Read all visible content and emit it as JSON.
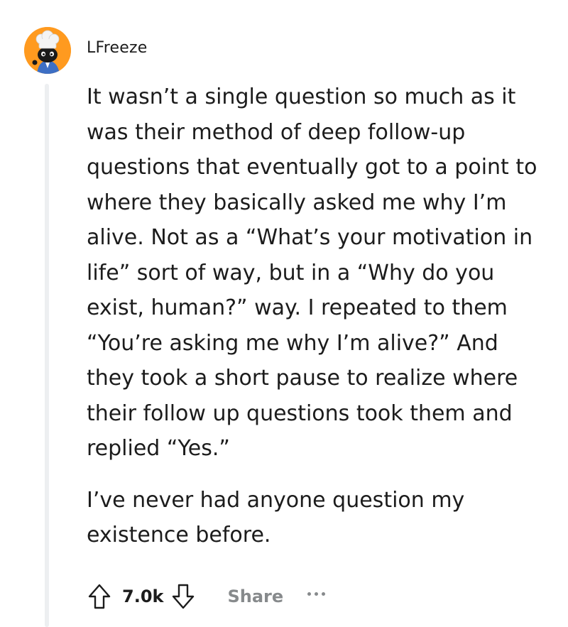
{
  "comment": {
    "username": "LFreeze",
    "paragraphs": [
      "It wasn’t a single question so much as it was their method of deep follow-up questions that eventually got to a point to where they basically asked me why I’m alive. Not as a “What’s your motivation in life” sort of way, but in a “Why do you exist, human?” way. I repeated to them “You’re asking me why I’m alive?” And they took a short pause to realize where their follow up questions took them and replied “Yes.”",
      "I’ve never had anyone question my existence before."
    ],
    "vote_count": "7.0k",
    "share_label": "Share"
  },
  "icons": {
    "upvote": "upvote-arrow-icon",
    "downvote": "downvote-arrow-icon",
    "more": "more-options-icon"
  },
  "colors": {
    "avatar_background": "#ff9a1f",
    "text": "#1c1c1c",
    "muted": "#878a8c",
    "thread_line": "#edeff1"
  }
}
